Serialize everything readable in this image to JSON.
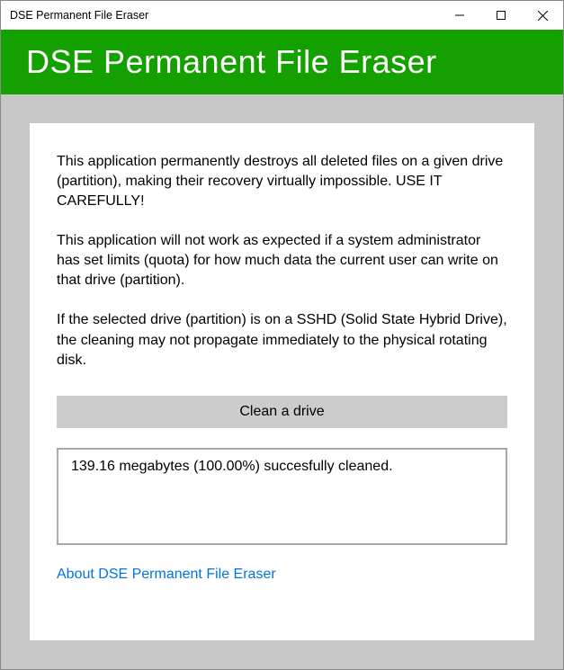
{
  "window": {
    "title": "DSE Permanent File Eraser"
  },
  "banner": {
    "title": "DSE Permanent File Eraser"
  },
  "main": {
    "paragraph1": "This application permanently destroys all deleted files on a given drive (partition), making their recovery virtually impossible. USE IT CAREFULLY!",
    "paragraph2": "This application will not work as expected if a system administrator has set limits (quota) for how much data the current user can write on that drive (partition).",
    "paragraph3": "If the selected drive (partition) is on a SSHD (Solid State Hybrid Drive), the cleaning may not propagate immediately to the physical rotating disk.",
    "clean_button_label": "Clean a drive",
    "status_text": "139.16 megabytes (100.00%) succesfully cleaned.",
    "about_link_label": "About DSE Permanent File Eraser"
  }
}
